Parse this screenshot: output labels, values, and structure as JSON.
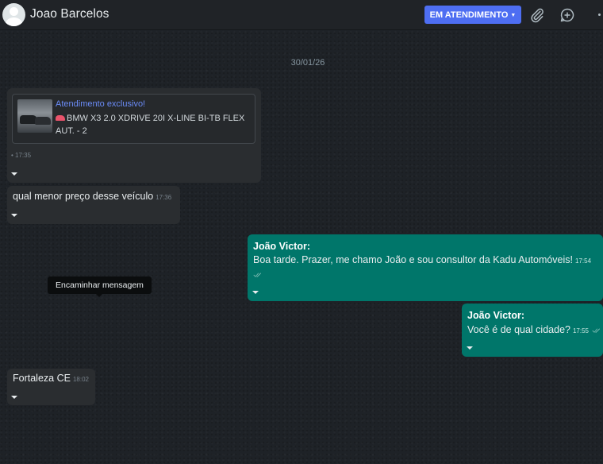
{
  "header": {
    "contact_name": "Joao Barcelos",
    "status_button_label": "EM ATENDIMENTO",
    "status_button_color": "#4e6ef2",
    "icons": [
      "avatar",
      "paperclip-icon",
      "new-chat-icon",
      "more-menu-icon"
    ]
  },
  "date_separator": "30/01/26",
  "messages": [
    {
      "direction": "incoming",
      "type": "product",
      "product_title": "Atendimento exclusivo!",
      "product_desc": "BMW X3 2.0 XDRIVE 20I X-LINE BI-TB FLEX AUT. - 2",
      "time": "17:35"
    },
    {
      "direction": "incoming",
      "text": "qual menor preço desse veículo",
      "time": "17:36"
    },
    {
      "direction": "outgoing",
      "sender": "João Victor:",
      "text": "Boa tarde. Prazer, me chamo João e sou consultor da Kadu Automóveis!",
      "time": "17:54"
    },
    {
      "direction": "outgoing",
      "sender": "João Victor:",
      "text": "Você é de qual cidade?",
      "time": "17:55"
    },
    {
      "direction": "incoming",
      "text": "Fortaleza CE",
      "time": "18:02"
    }
  ],
  "tooltip": "Encaminhar mensagem",
  "colors": {
    "incoming_bubble": "#2a2d30",
    "outgoing_bubble": "#00766a",
    "chat_background": "#1e2227",
    "header_background": "#202327"
  }
}
